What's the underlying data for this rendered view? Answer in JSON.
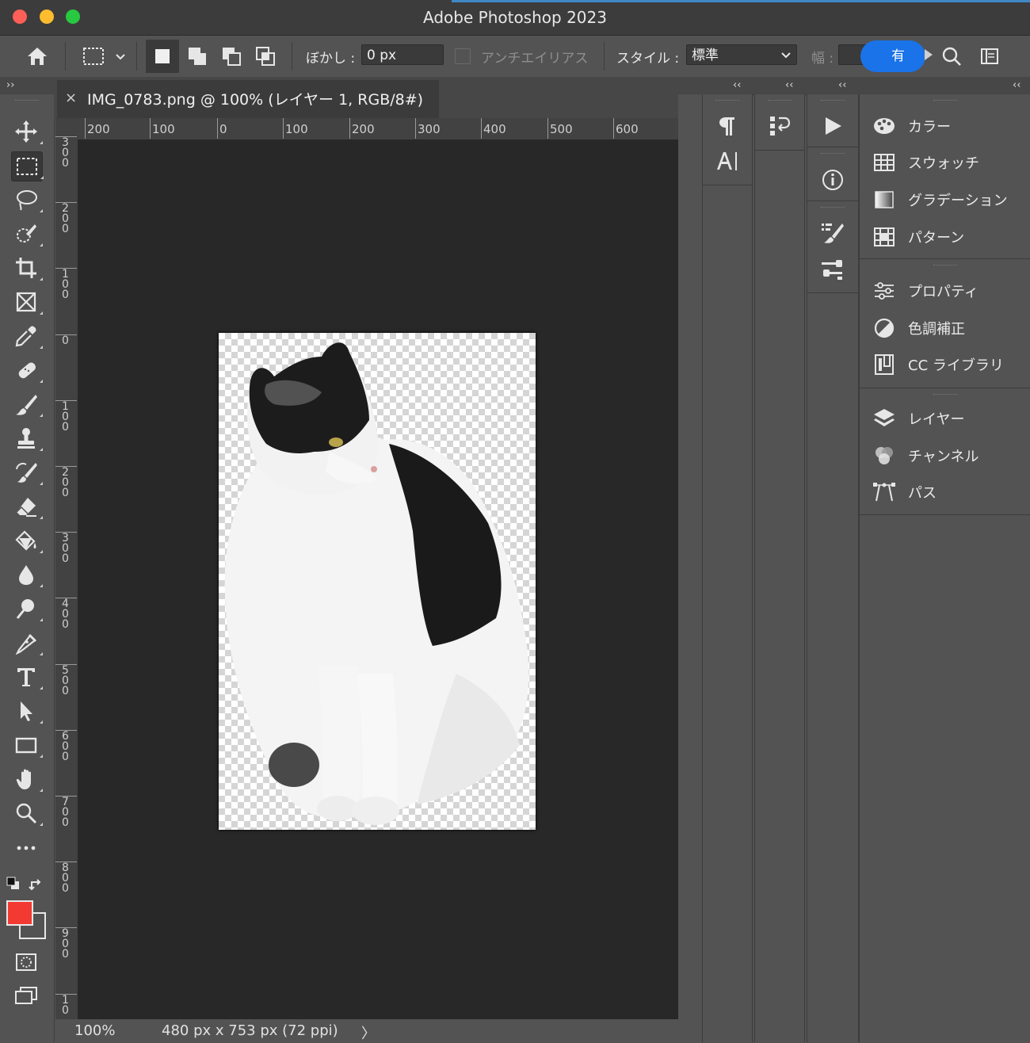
{
  "app": {
    "title": "Adobe Photoshop 2023"
  },
  "options": {
    "feather_label": "ぼかし :",
    "feather_value": "0 px",
    "antialias_label": "アンチエイリアス",
    "style_label": "スタイル :",
    "style_value": "標準",
    "width_label": "幅 :",
    "tooltip_text": "有"
  },
  "document": {
    "tab_title": "IMG_0783.png @ 100% (レイヤー 1, RGB/8#)",
    "ruler_h": [
      "200",
      "100",
      "0",
      "100",
      "200",
      "300",
      "400",
      "500",
      "600"
    ],
    "ruler_v": [
      "300",
      "200",
      "100",
      "0",
      "100",
      "200",
      "300",
      "400",
      "500",
      "600",
      "700",
      "800",
      "900",
      "10"
    ],
    "zoom": "100%",
    "info": "480 px x 753 px (72 ppi)",
    "status_arrow": "〉"
  },
  "colors": {
    "foreground": "#f23a33",
    "background": "#535353",
    "accent": "#1a73e8"
  },
  "panels": {
    "group1": [
      {
        "label": "カラー",
        "icon": "color-wheel-icon"
      },
      {
        "label": "スウォッチ",
        "icon": "swatches-grid-icon"
      },
      {
        "label": "グラデーション",
        "icon": "gradient-icon"
      },
      {
        "label": "パターン",
        "icon": "pattern-icon"
      }
    ],
    "group2": [
      {
        "label": "プロパティ",
        "icon": "properties-sliders-icon"
      },
      {
        "label": "色調補正",
        "icon": "adjustments-icon"
      },
      {
        "label": "CC ライブラリ",
        "icon": "cc-libraries-icon"
      }
    ],
    "group3": [
      {
        "label": "レイヤー",
        "icon": "layers-icon"
      },
      {
        "label": "チャンネル",
        "icon": "channels-icon"
      },
      {
        "label": "パス",
        "icon": "paths-icon"
      }
    ]
  }
}
